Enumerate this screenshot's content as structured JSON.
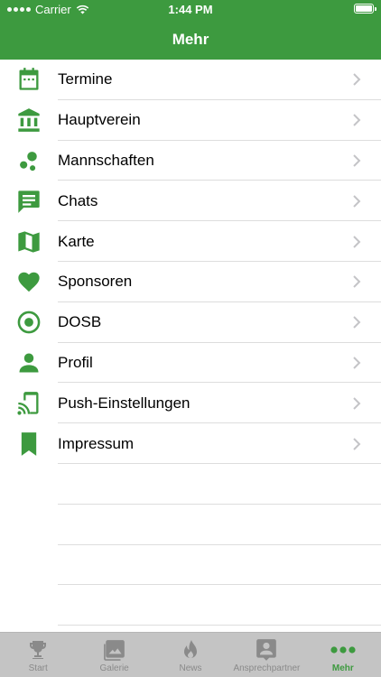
{
  "status": {
    "carrier": "Carrier",
    "time": "1:44 PM"
  },
  "nav": {
    "title": "Mehr"
  },
  "menu": [
    {
      "label": "Termine",
      "icon": "calendar-icon"
    },
    {
      "label": "Hauptverein",
      "icon": "bank-icon"
    },
    {
      "label": "Mannschaften",
      "icon": "bubbles-icon"
    },
    {
      "label": "Chats",
      "icon": "chat-icon"
    },
    {
      "label": "Karte",
      "icon": "map-icon"
    },
    {
      "label": "Sponsoren",
      "icon": "heart-icon"
    },
    {
      "label": "DOSB",
      "icon": "target-icon"
    },
    {
      "label": "Profil",
      "icon": "person-icon"
    },
    {
      "label": "Push-Einstellungen",
      "icon": "cast-icon"
    },
    {
      "label": "Impressum",
      "icon": "bookmark-icon"
    }
  ],
  "tabs": [
    {
      "label": "Start",
      "icon": "trophy-icon"
    },
    {
      "label": "Galerie",
      "icon": "gallery-icon"
    },
    {
      "label": "News",
      "icon": "flame-icon"
    },
    {
      "label": "Ansprechpartner",
      "icon": "contact-icon"
    },
    {
      "label": "Mehr",
      "icon": "more-icon"
    }
  ],
  "colors": {
    "accent": "#3d9a3f",
    "tabbar": "#c4c4c4",
    "tab_inactive": "#8a8a8a",
    "separator": "#dddddd"
  }
}
